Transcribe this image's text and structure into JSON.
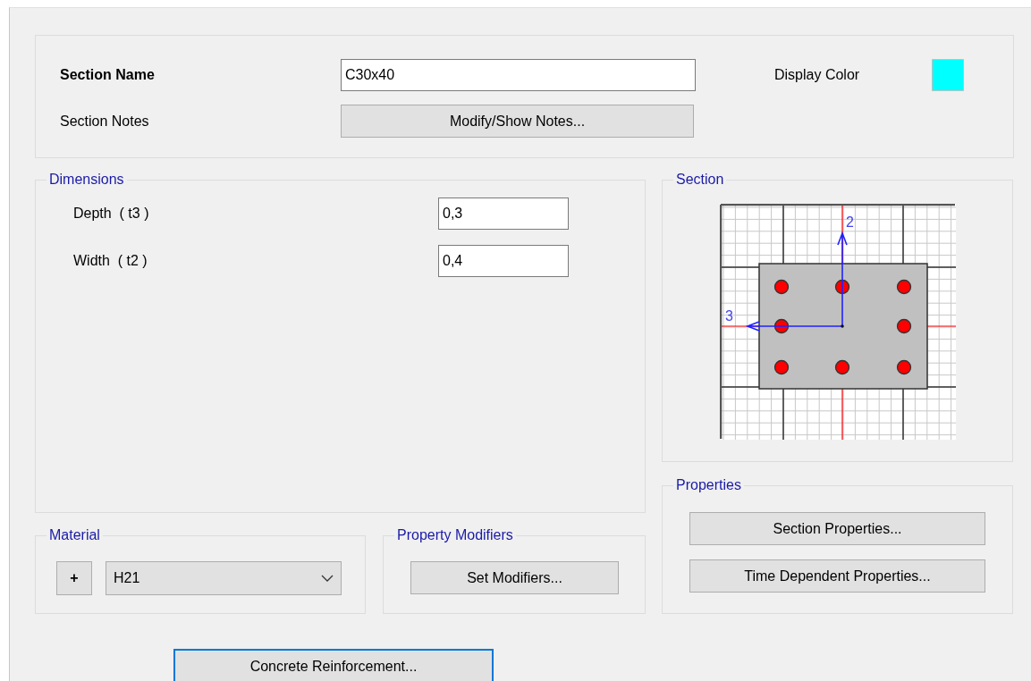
{
  "header": {
    "section_name_label": "Section Name",
    "section_name": "C30x40",
    "display_color_label": "Display Color",
    "display_color": {
      "color": "#00ffff"
    },
    "section_notes_label": "Section Notes",
    "notes_button": "Modify/Show Notes..."
  },
  "dimensions": {
    "title": "Dimensions",
    "fields": [
      {
        "label": "Depth  ( t3 )",
        "value": "0,3"
      },
      {
        "label": "Width  ( t2 )",
        "value": "0,4"
      }
    ]
  },
  "section": {
    "title": "Section",
    "axis_labels": [
      "2",
      "3"
    ]
  },
  "material": {
    "title": "Material",
    "add_button": "+",
    "value": "H21"
  },
  "property_modifiers": {
    "title": "Property Modifiers",
    "button": "Set Modifiers..."
  },
  "properties": {
    "title": "Properties",
    "buttons": [
      "Section Properties...",
      "Time Dependent Properties..."
    ]
  },
  "reinforcement_button": "Concrete Reinforcement..."
}
